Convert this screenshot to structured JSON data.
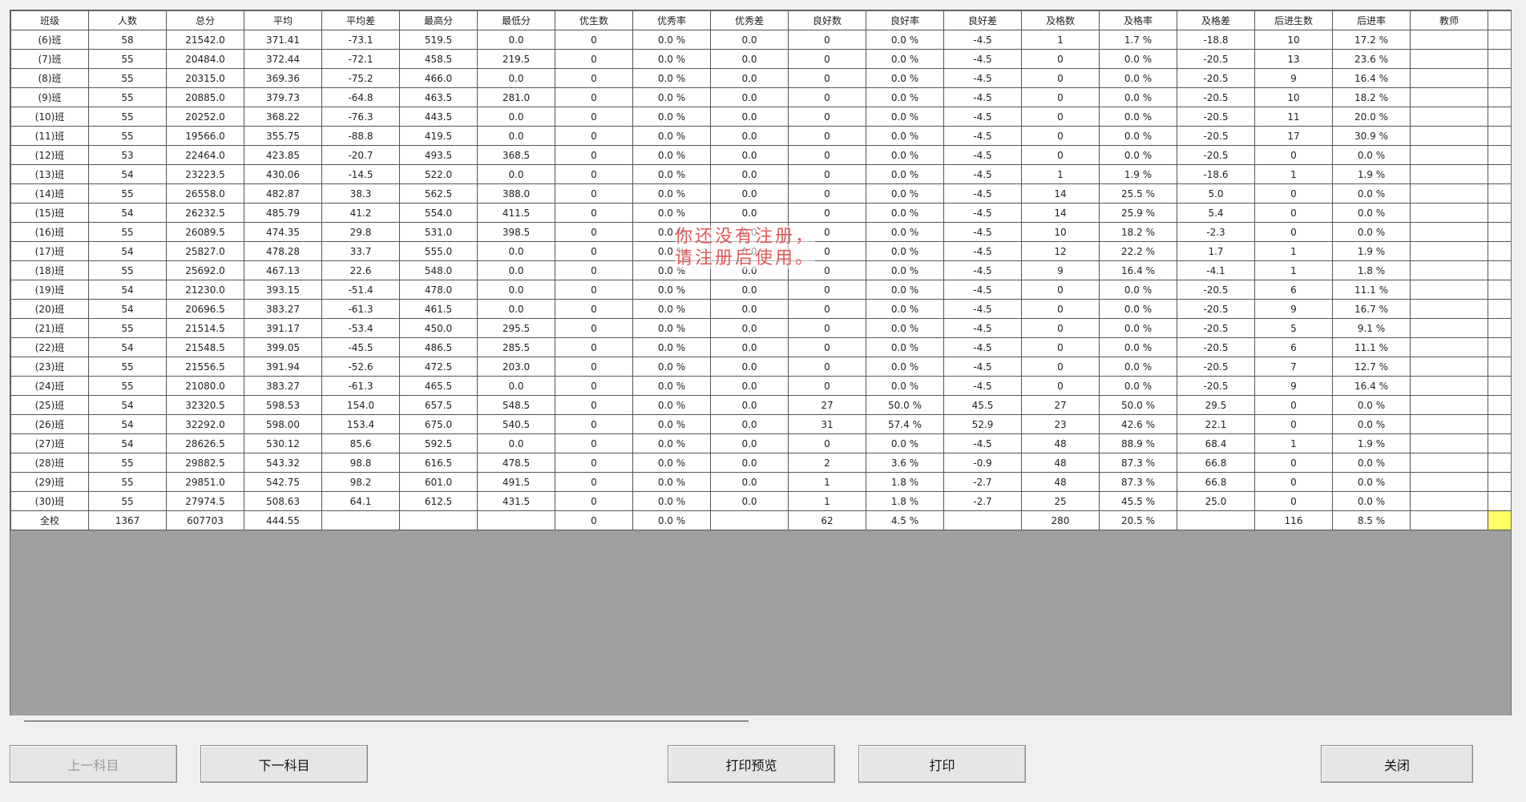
{
  "table": {
    "columns": [
      "班级",
      "人数",
      "总分",
      "平均",
      "平均差",
      "最高分",
      "最低分",
      "优生数",
      "优秀率",
      "优秀差",
      "良好数",
      "良好率",
      "良好差",
      "及格数",
      "及格率",
      "及格差",
      "后进生数",
      "后进率",
      "教师"
    ],
    "rows": [
      [
        "(6)班",
        "58",
        "21542.0",
        "371.41",
        "-73.1",
        "519.5",
        "0.0",
        "0",
        "0.0 %",
        "0.0",
        "0",
        "0.0 %",
        "-4.5",
        "1",
        "1.7 %",
        "-18.8",
        "10",
        "17.2 %",
        ""
      ],
      [
        "(7)班",
        "55",
        "20484.0",
        "372.44",
        "-72.1",
        "458.5",
        "219.5",
        "0",
        "0.0 %",
        "0.0",
        "0",
        "0.0 %",
        "-4.5",
        "0",
        "0.0 %",
        "-20.5",
        "13",
        "23.6 %",
        ""
      ],
      [
        "(8)班",
        "55",
        "20315.0",
        "369.36",
        "-75.2",
        "466.0",
        "0.0",
        "0",
        "0.0 %",
        "0.0",
        "0",
        "0.0 %",
        "-4.5",
        "0",
        "0.0 %",
        "-20.5",
        "9",
        "16.4 %",
        ""
      ],
      [
        "(9)班",
        "55",
        "20885.0",
        "379.73",
        "-64.8",
        "463.5",
        "281.0",
        "0",
        "0.0 %",
        "0.0",
        "0",
        "0.0 %",
        "-4.5",
        "0",
        "0.0 %",
        "-20.5",
        "10",
        "18.2 %",
        ""
      ],
      [
        "(10)班",
        "55",
        "20252.0",
        "368.22",
        "-76.3",
        "443.5",
        "0.0",
        "0",
        "0.0 %",
        "0.0",
        "0",
        "0.0 %",
        "-4.5",
        "0",
        "0.0 %",
        "-20.5",
        "11",
        "20.0 %",
        ""
      ],
      [
        "(11)班",
        "55",
        "19566.0",
        "355.75",
        "-88.8",
        "419.5",
        "0.0",
        "0",
        "0.0 %",
        "0.0",
        "0",
        "0.0 %",
        "-4.5",
        "0",
        "0.0 %",
        "-20.5",
        "17",
        "30.9 %",
        ""
      ],
      [
        "(12)班",
        "53",
        "22464.0",
        "423.85",
        "-20.7",
        "493.5",
        "368.5",
        "0",
        "0.0 %",
        "0.0",
        "0",
        "0.0 %",
        "-4.5",
        "0",
        "0.0 %",
        "-20.5",
        "0",
        "0.0 %",
        ""
      ],
      [
        "(13)班",
        "54",
        "23223.5",
        "430.06",
        "-14.5",
        "522.0",
        "0.0",
        "0",
        "0.0 %",
        "0.0",
        "0",
        "0.0 %",
        "-4.5",
        "1",
        "1.9 %",
        "-18.6",
        "1",
        "1.9 %",
        ""
      ],
      [
        "(14)班",
        "55",
        "26558.0",
        "482.87",
        "38.3",
        "562.5",
        "388.0",
        "0",
        "0.0 %",
        "0.0",
        "0",
        "0.0 %",
        "-4.5",
        "14",
        "25.5 %",
        "5.0",
        "0",
        "0.0 %",
        ""
      ],
      [
        "(15)班",
        "54",
        "26232.5",
        "485.79",
        "41.2",
        "554.0",
        "411.5",
        "0",
        "0.0 %",
        "0.0",
        "0",
        "0.0 %",
        "-4.5",
        "14",
        "25.9 %",
        "5.4",
        "0",
        "0.0 %",
        ""
      ],
      [
        "(16)班",
        "55",
        "26089.5",
        "474.35",
        "29.8",
        "531.0",
        "398.5",
        "0",
        "0.0 %",
        "0.0",
        "0",
        "0.0 %",
        "-4.5",
        "10",
        "18.2 %",
        "-2.3",
        "0",
        "0.0 %",
        ""
      ],
      [
        "(17)班",
        "54",
        "25827.0",
        "478.28",
        "33.7",
        "555.0",
        "0.0",
        "0",
        "0.0 %",
        "0.0",
        "0",
        "0.0 %",
        "-4.5",
        "12",
        "22.2 %",
        "1.7",
        "1",
        "1.9 %",
        ""
      ],
      [
        "(18)班",
        "55",
        "25692.0",
        "467.13",
        "22.6",
        "548.0",
        "0.0",
        "0",
        "0.0 %",
        "0.0",
        "0",
        "0.0 %",
        "-4.5",
        "9",
        "16.4 %",
        "-4.1",
        "1",
        "1.8 %",
        ""
      ],
      [
        "(19)班",
        "54",
        "21230.0",
        "393.15",
        "-51.4",
        "478.0",
        "0.0",
        "0",
        "0.0 %",
        "0.0",
        "0",
        "0.0 %",
        "-4.5",
        "0",
        "0.0 %",
        "-20.5",
        "6",
        "11.1 %",
        ""
      ],
      [
        "(20)班",
        "54",
        "20696.5",
        "383.27",
        "-61.3",
        "461.5",
        "0.0",
        "0",
        "0.0 %",
        "0.0",
        "0",
        "0.0 %",
        "-4.5",
        "0",
        "0.0 %",
        "-20.5",
        "9",
        "16.7 %",
        ""
      ],
      [
        "(21)班",
        "55",
        "21514.5",
        "391.17",
        "-53.4",
        "450.0",
        "295.5",
        "0",
        "0.0 %",
        "0.0",
        "0",
        "0.0 %",
        "-4.5",
        "0",
        "0.0 %",
        "-20.5",
        "5",
        "9.1 %",
        ""
      ],
      [
        "(22)班",
        "54",
        "21548.5",
        "399.05",
        "-45.5",
        "486.5",
        "285.5",
        "0",
        "0.0 %",
        "0.0",
        "0",
        "0.0 %",
        "-4.5",
        "0",
        "0.0 %",
        "-20.5",
        "6",
        "11.1 %",
        ""
      ],
      [
        "(23)班",
        "55",
        "21556.5",
        "391.94",
        "-52.6",
        "472.5",
        "203.0",
        "0",
        "0.0 %",
        "0.0",
        "0",
        "0.0 %",
        "-4.5",
        "0",
        "0.0 %",
        "-20.5",
        "7",
        "12.7 %",
        ""
      ],
      [
        "(24)班",
        "55",
        "21080.0",
        "383.27",
        "-61.3",
        "465.5",
        "0.0",
        "0",
        "0.0 %",
        "0.0",
        "0",
        "0.0 %",
        "-4.5",
        "0",
        "0.0 %",
        "-20.5",
        "9",
        "16.4 %",
        ""
      ],
      [
        "(25)班",
        "54",
        "32320.5",
        "598.53",
        "154.0",
        "657.5",
        "548.5",
        "0",
        "0.0 %",
        "0.0",
        "27",
        "50.0 %",
        "45.5",
        "27",
        "50.0 %",
        "29.5",
        "0",
        "0.0 %",
        ""
      ],
      [
        "(26)班",
        "54",
        "32292.0",
        "598.00",
        "153.4",
        "675.0",
        "540.5",
        "0",
        "0.0 %",
        "0.0",
        "31",
        "57.4 %",
        "52.9",
        "23",
        "42.6 %",
        "22.1",
        "0",
        "0.0 %",
        ""
      ],
      [
        "(27)班",
        "54",
        "28626.5",
        "530.12",
        "85.6",
        "592.5",
        "0.0",
        "0",
        "0.0 %",
        "0.0",
        "0",
        "0.0 %",
        "-4.5",
        "48",
        "88.9 %",
        "68.4",
        "1",
        "1.9 %",
        ""
      ],
      [
        "(28)班",
        "55",
        "29882.5",
        "543.32",
        "98.8",
        "616.5",
        "478.5",
        "0",
        "0.0 %",
        "0.0",
        "2",
        "3.6 %",
        "-0.9",
        "48",
        "87.3 %",
        "66.8",
        "0",
        "0.0 %",
        ""
      ],
      [
        "(29)班",
        "55",
        "29851.0",
        "542.75",
        "98.2",
        "601.0",
        "491.5",
        "0",
        "0.0 %",
        "0.0",
        "1",
        "1.8 %",
        "-2.7",
        "48",
        "87.3 %",
        "66.8",
        "0",
        "0.0 %",
        ""
      ],
      [
        "(30)班",
        "55",
        "27974.5",
        "508.63",
        "64.1",
        "612.5",
        "431.5",
        "0",
        "0.0 %",
        "0.0",
        "1",
        "1.8 %",
        "-2.7",
        "25",
        "45.5 %",
        "25.0",
        "0",
        "0.0 %",
        ""
      ],
      [
        "全校",
        "1367",
        "607703",
        "444.55",
        "",
        "",
        "",
        "0",
        "0.0 %",
        "",
        "62",
        "4.5 %",
        "",
        "280",
        "20.5 %",
        "",
        "116",
        "8.5 %",
        ""
      ]
    ]
  },
  "watermark": {
    "line1": "你还没有注册，",
    "line2": "请注册后使用。",
    "color": "#e05a5a"
  },
  "buttons": {
    "prev_subject": "上一科目",
    "next_subject": "下一科目",
    "print_preview": "打印预览",
    "print": "打印",
    "close": "关闭"
  },
  "colors": {
    "grid_empty_area": "#a0a0a0",
    "window_background": "#f0f0f0",
    "highlight_cell": "#ffff66"
  }
}
